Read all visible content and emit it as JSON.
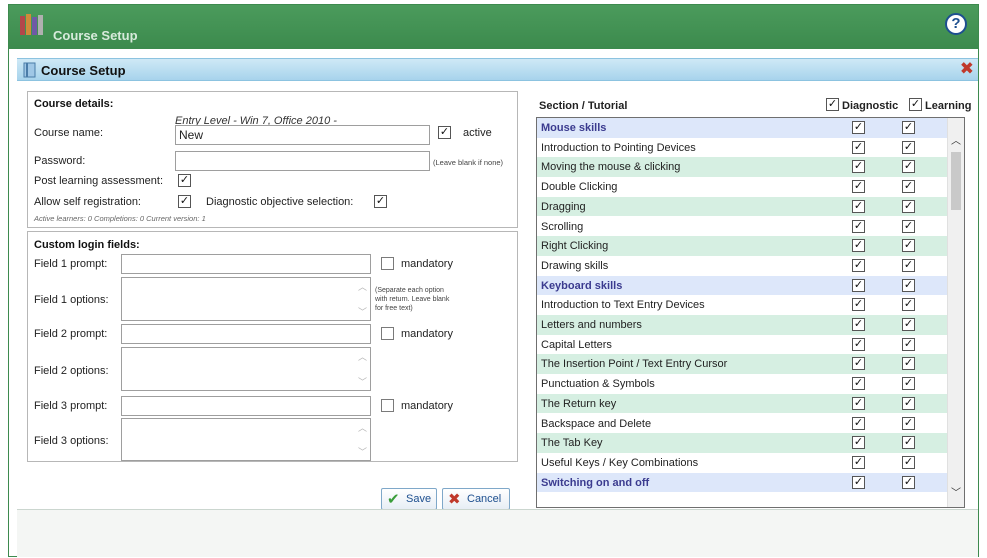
{
  "app": {
    "title": "Course Setup"
  },
  "dialog": {
    "title": "Course Setup"
  },
  "course_details": {
    "heading": "Course details:",
    "level_text": "Entry Level - Win 7, Office 2010 -",
    "name_label": "Course name:",
    "name_value": "New",
    "active_label": "active",
    "active_checked": true,
    "password_label": "Password:",
    "password_value": "",
    "password_note": "(Leave blank if none)",
    "post_learning_label": "Post learning assessment:",
    "post_learning_checked": true,
    "self_reg_label": "Allow self registration:",
    "self_reg_checked": true,
    "diag_obj_label": "Diagnostic objective selection:",
    "diag_obj_checked": true,
    "stats_text": "Active learners: 0   Completions: 0   Current version: 1"
  },
  "custom_login": {
    "heading": "Custom login fields:",
    "fields": [
      {
        "prompt_label": "Field 1 prompt:",
        "options_label": "Field 1 options:",
        "mandatory_label": "mandatory"
      },
      {
        "prompt_label": "Field 2 prompt:",
        "options_label": "Field 2 options:",
        "mandatory_label": "mandatory"
      },
      {
        "prompt_label": "Field 3 prompt:",
        "options_label": "Field 3 options:",
        "mandatory_label": "mandatory"
      }
    ],
    "options_note": "(Separate each option with return. Leave blank for free text)"
  },
  "buttons": {
    "save": "Save",
    "cancel": "Cancel"
  },
  "tutorials": {
    "heading": "Section / Tutorial",
    "diagnostic_label": "Diagnostic",
    "learning_label": "Learning",
    "rows": [
      {
        "label": "Mouse skills",
        "section": true
      },
      {
        "label": "Introduction to Pointing Devices",
        "section": false
      },
      {
        "label": "Moving the mouse & clicking",
        "section": false
      },
      {
        "label": "Double Clicking",
        "section": false
      },
      {
        "label": "Dragging",
        "section": false
      },
      {
        "label": "Scrolling",
        "section": false
      },
      {
        "label": "Right Clicking",
        "section": false
      },
      {
        "label": "Drawing skills",
        "section": false
      },
      {
        "label": "Keyboard skills",
        "section": true
      },
      {
        "label": "Introduction to Text Entry Devices",
        "section": false
      },
      {
        "label": "Letters and numbers",
        "section": false
      },
      {
        "label": "Capital Letters",
        "section": false
      },
      {
        "label": "The Insertion Point / Text Entry Cursor",
        "section": false
      },
      {
        "label": "Punctuation & Symbols",
        "section": false
      },
      {
        "label": "The Return key",
        "section": false
      },
      {
        "label": "Backspace and Delete",
        "section": false
      },
      {
        "label": "The Tab Key",
        "section": false
      },
      {
        "label": "Useful Keys / Key Combinations",
        "section": false
      },
      {
        "label": "Switching on and off",
        "section": true
      }
    ]
  },
  "colors": {
    "titlebar": "#3c8a4d",
    "dialog_header": "#a7d3ec",
    "section_row": "#dde7fa",
    "alt_row": "#d6efe2",
    "section_text": "#3b3b8f"
  },
  "icons": {
    "app": "books-icon",
    "help": "help-icon",
    "close": "close-icon",
    "dialog": "document-icon",
    "save": "checkmark-icon",
    "cancel": "cross-icon"
  }
}
